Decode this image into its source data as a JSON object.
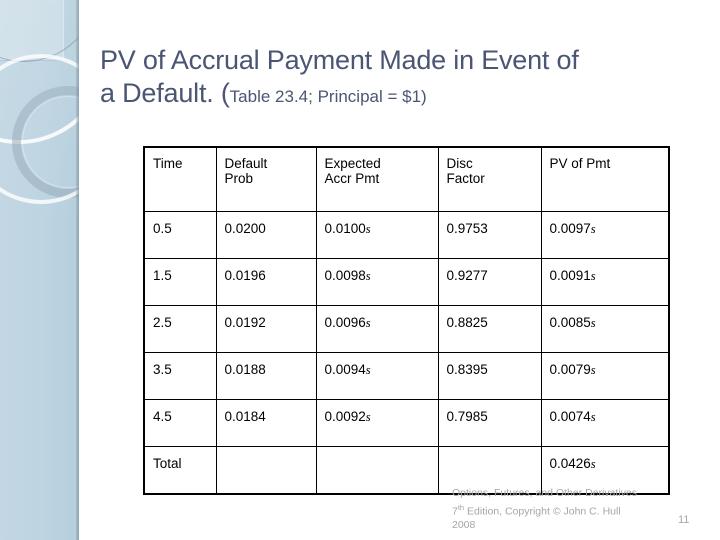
{
  "slide": {
    "title_line1": "PV of Accrual Payment Made in Event of",
    "title_line2_main": "a Default. ",
    "title_paren_open": "(",
    "title_subnote": "Table 23.4; Principal = $1)",
    "title_color": "#4b5574",
    "accent_band_color": "#bdd4e1"
  },
  "table": {
    "headers": [
      "Time",
      "Default Prob",
      "Expected Accr Pmt",
      "Disc Factor",
      "PV of Pmt"
    ],
    "headers_wrapped": [
      {
        "l1": "Time",
        "l2": ""
      },
      {
        "l1": "Default",
        "l2": "Prob"
      },
      {
        "l1": "Expected",
        "l2": "Accr Pmt"
      },
      {
        "l1": "Disc",
        "l2": "Factor"
      },
      {
        "l1": "PV of Pmt",
        "l2": ""
      }
    ],
    "rows": [
      {
        "time": "0.5",
        "default_prob": "0.0200",
        "expected_accr_pmt": "0.0100",
        "expected_accr_pmt_unit": "s",
        "disc_factor": "0.9753",
        "pv_of_pmt": "0.0097",
        "pv_of_pmt_unit": "s"
      },
      {
        "time": "1.5",
        "default_prob": "0.0196",
        "expected_accr_pmt": "0.0098",
        "expected_accr_pmt_unit": "s",
        "disc_factor": "0.9277",
        "pv_of_pmt": "0.0091",
        "pv_of_pmt_unit": "s"
      },
      {
        "time": "2.5",
        "default_prob": "0.0192",
        "expected_accr_pmt": "0.0096",
        "expected_accr_pmt_unit": "s",
        "disc_factor": "0.8825",
        "pv_of_pmt": "0.0085",
        "pv_of_pmt_unit": "s"
      },
      {
        "time": "3.5",
        "default_prob": "0.0188",
        "expected_accr_pmt": "0.0094",
        "expected_accr_pmt_unit": "s",
        "disc_factor": "0.8395",
        "pv_of_pmt": "0.0079",
        "pv_of_pmt_unit": "s"
      },
      {
        "time": "4.5",
        "default_prob": "0.0184",
        "expected_accr_pmt": "0.0092",
        "expected_accr_pmt_unit": "s",
        "disc_factor": "0.7985",
        "pv_of_pmt": "0.0074",
        "pv_of_pmt_unit": "s"
      }
    ],
    "total_row": {
      "time": "Total",
      "default_prob": "",
      "expected_accr_pmt": "",
      "expected_accr_pmt_unit": "",
      "disc_factor": "",
      "pv_of_pmt": "0.0426",
      "pv_of_pmt_unit": "s"
    }
  },
  "footer": {
    "line1": "Options, Futures, and Other Derivatives",
    "line2_pre": "7",
    "line2_sup": "th",
    "line2_post": " Edition, Copyright © John C. Hull",
    "line3": "2008",
    "slide_number": "11"
  }
}
